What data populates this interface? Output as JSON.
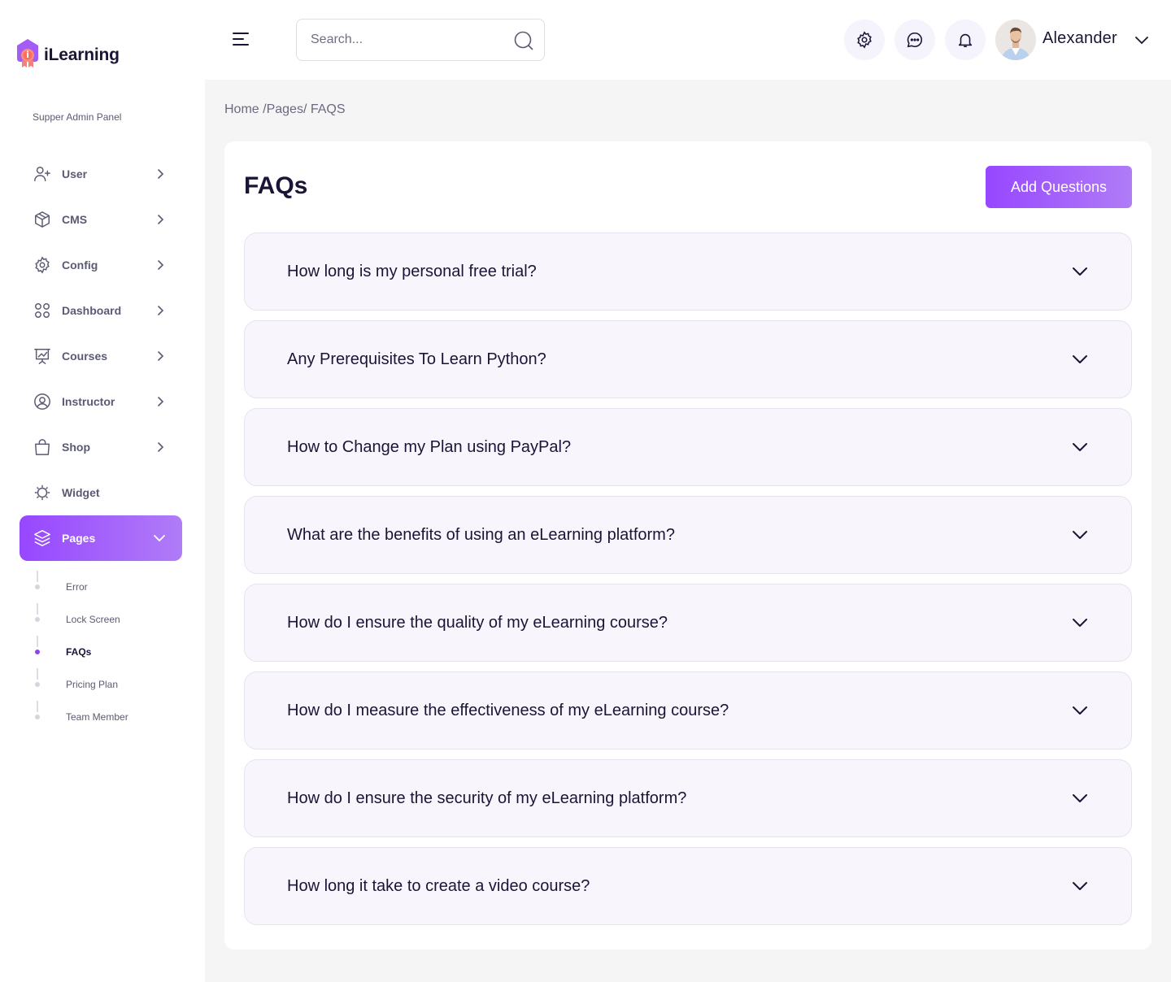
{
  "brand": {
    "name": "iLearning",
    "panel_label": "Supper Admin Panel"
  },
  "sidebar": {
    "items": [
      {
        "label": "User",
        "icon": "user-plus-icon",
        "has_chevron": true
      },
      {
        "label": "CMS",
        "icon": "box-icon",
        "has_chevron": true
      },
      {
        "label": "Config",
        "icon": "gear-icon",
        "has_chevron": true
      },
      {
        "label": "Dashboard",
        "icon": "grid-icon",
        "has_chevron": true
      },
      {
        "label": "Courses",
        "icon": "presentation-icon",
        "has_chevron": true
      },
      {
        "label": "Instructor",
        "icon": "user-circle-icon",
        "has_chevron": true
      },
      {
        "label": "Shop",
        "icon": "shopping-bag-icon",
        "has_chevron": true
      },
      {
        "label": "Widget",
        "icon": "cog-badge-icon",
        "has_chevron": false
      },
      {
        "label": "Pages",
        "icon": "layers-icon",
        "has_chevron": true,
        "active": true
      }
    ],
    "subitems": [
      {
        "label": "Error"
      },
      {
        "label": "Lock Screen"
      },
      {
        "label": "FAQs",
        "active": true
      },
      {
        "label": "Pricing Plan"
      },
      {
        "label": "Team Member"
      }
    ]
  },
  "header": {
    "search_placeholder": "Search...",
    "user_name": "Alexander",
    "buttons": [
      "settings-icon",
      "chat-icon",
      "bell-icon"
    ]
  },
  "breadcrumb": "Home /Pages/ FAQS",
  "main": {
    "title": "FAQs",
    "add_button": "Add Questions",
    "faqs": [
      "How long is my personal free trial?",
      "Any Prerequisites To Learn Python?",
      "How to Change my Plan using PayPal?",
      "What are the benefits of using an eLearning platform?",
      "How do I ensure the quality of my eLearning course?",
      "How do I measure the effectiveness of my eLearning course?",
      "How do I ensure the security of my eLearning platform?",
      "How long it take to create a video course?"
    ]
  },
  "colors": {
    "accent": "#9747ff",
    "accent_light": "#b07cf7",
    "text": "#1a1537",
    "muted": "#5a5a72",
    "faq_bg": "#f8f6fc"
  }
}
